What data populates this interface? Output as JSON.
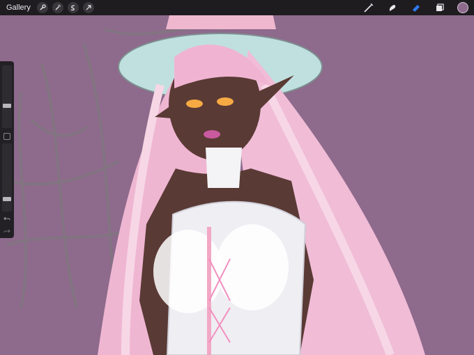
{
  "topbar": {
    "gallery_label": "Gallery",
    "left_tools": [
      "wrench-icon",
      "magic-wand-icon",
      "selection-s-icon",
      "transform-arrow-icon"
    ],
    "right_tools": [
      "brush-icon",
      "smudge-icon",
      "eraser-icon",
      "layers-icon"
    ],
    "color": "#8e6a8c"
  },
  "sidebar": {
    "brush_size_level": 0.35,
    "opacity_level": 0.16
  }
}
